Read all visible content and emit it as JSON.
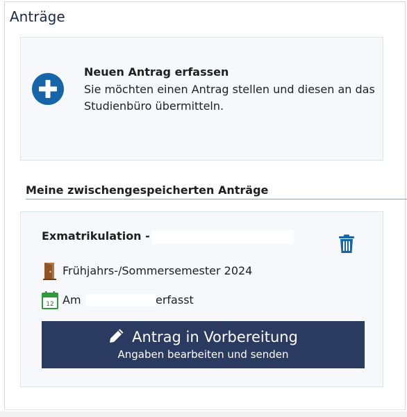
{
  "page": {
    "title": "Anträge"
  },
  "new_request": {
    "title": "Neuen Antrag erfassen",
    "description": "Sie möchten einen Antrag stellen und diesen an das Studienbüro übermitteln.",
    "icon": "plus-circle-icon",
    "icon_color": "#1565a8"
  },
  "saved_section": {
    "heading": "Meine zwischengespeicherten Anträge"
  },
  "draft": {
    "title": "Exmatrikulation -",
    "semester": "Frühjahrs-/Sommersemester 2024",
    "date_prefix": "Am",
    "date_suffix": "erfasst",
    "semester_icon": "door-icon",
    "date_icon": "calendar-icon",
    "calendar_day": "12",
    "delete_icon": "trash-icon",
    "action_label": "Antrag in Vorbereitung",
    "action_sublabel": "Angaben bearbeiten und senden",
    "action_icon": "pencil-icon",
    "action_color": "#2b3a61",
    "icon_colors": {
      "trash": "#1565a8",
      "door": "#b9723a",
      "calendar": "#2e9a3b"
    }
  }
}
